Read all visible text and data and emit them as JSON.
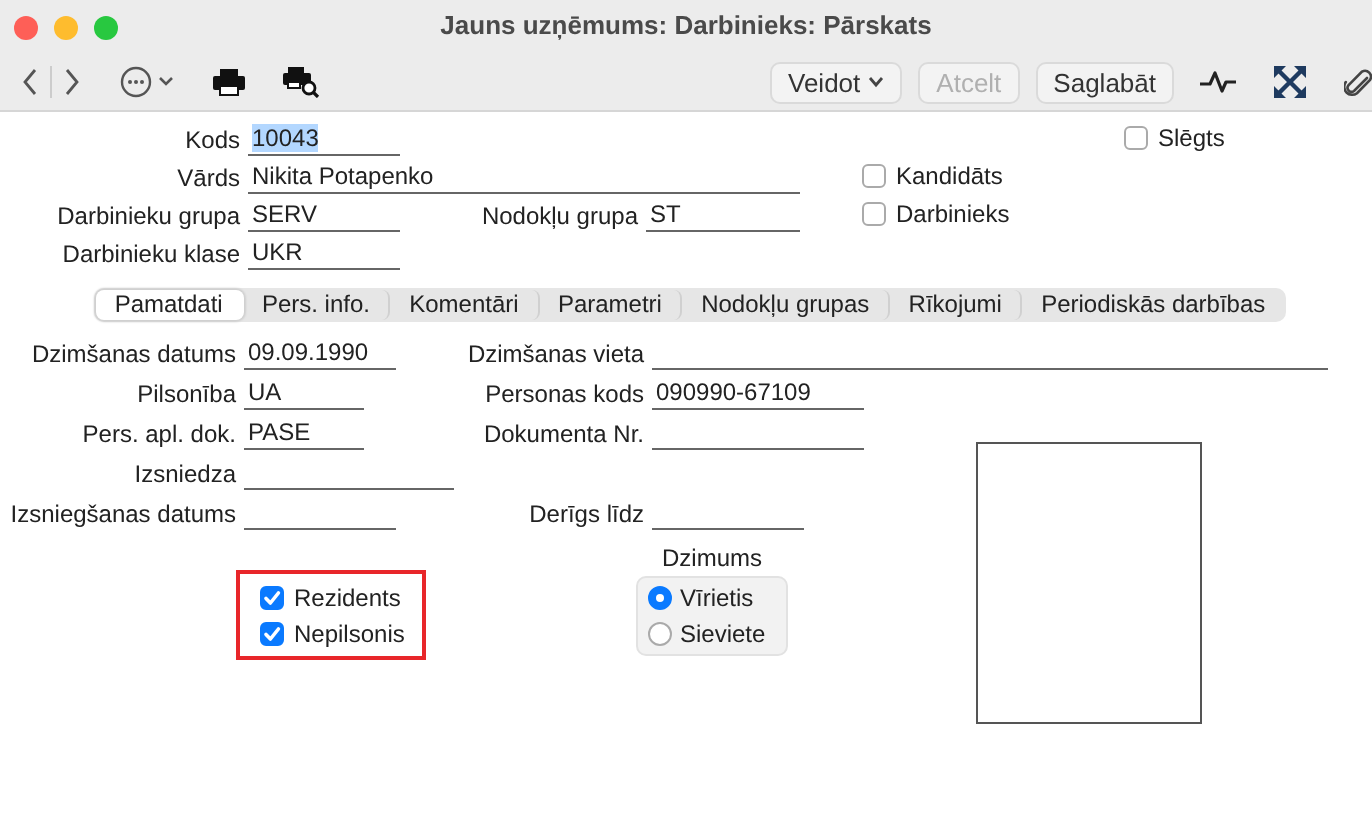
{
  "window": {
    "title": "Jauns uzņēmums: Darbinieks: Pārskats"
  },
  "toolbar": {
    "buttons": [
      {
        "label": "Veidot",
        "kind": "menu",
        "disabled": false
      },
      {
        "label": "Atcelt",
        "kind": "plain",
        "disabled": true
      },
      {
        "label": "Saglabāt",
        "kind": "plain",
        "disabled": false
      }
    ]
  },
  "header": {
    "fields": [
      {
        "label": "Kods",
        "value": "10043",
        "highlighted": true
      },
      {
        "label": "Vārds",
        "value": "Nikita Potapenko",
        "highlighted": false
      },
      {
        "label": "Darbinieku grupa",
        "value": "SERV",
        "highlighted": false
      },
      {
        "label": "Nodokļu grupa",
        "value": "ST",
        "highlighted": false
      },
      {
        "label": "Darbinieku klase",
        "value": "UKR",
        "highlighted": false
      }
    ],
    "checkboxes": [
      {
        "label": "Slēgts",
        "checked": false
      },
      {
        "label": "Kandidāts",
        "checked": false
      },
      {
        "label": "Darbinieks",
        "checked": false
      }
    ]
  },
  "tabs": [
    {
      "label": "Pamatdati",
      "selected": true
    },
    {
      "label": "Pers. info.",
      "selected": false
    },
    {
      "label": "Komentāri",
      "selected": false
    },
    {
      "label": "Parametri",
      "selected": false
    },
    {
      "label": "Nodokļu grupas",
      "selected": false
    },
    {
      "label": "Rīkojumi",
      "selected": false
    },
    {
      "label": "Periodiskās darbības",
      "selected": false
    }
  ],
  "details": {
    "fields": [
      {
        "label": "Dzimšanas datums",
        "value": "09.09.1990"
      },
      {
        "label": "Dzimšanas vieta"
      },
      {
        "label": "Pilsonība",
        "value": "UA"
      },
      {
        "label": "Personas kods",
        "value": "090990-67109"
      },
      {
        "label": "Pers. apl. dok.",
        "value": "PASE"
      },
      {
        "label": "Dokumenta Nr."
      },
      {
        "label": "Izsniedza"
      },
      {
        "label": "Izsniegšanas datums"
      },
      {
        "label": "Derīgs līdz"
      }
    ],
    "checkboxes": [
      {
        "label": "Rezidents",
        "checked": true
      },
      {
        "label": "Nepilsonis",
        "checked": true
      }
    ],
    "gender": {
      "label": "Dzimums",
      "options": [
        {
          "label": "Vīrietis",
          "selected": true
        },
        {
          "label": "Sieviete",
          "selected": false
        }
      ]
    }
  }
}
